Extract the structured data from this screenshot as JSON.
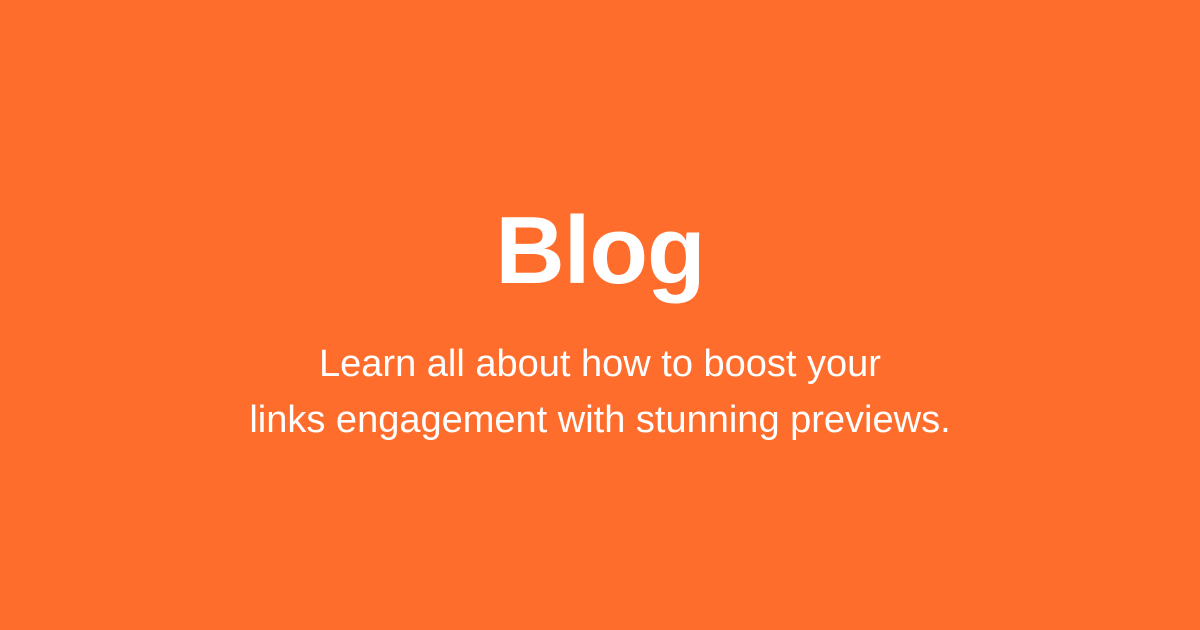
{
  "page": {
    "background_color": "#ff6d2c",
    "text_color": "#ffffff"
  },
  "hero": {
    "title": "Blog",
    "subtitle_lines": [
      "Learn all about how to boost your",
      "links engagement with stunning previews."
    ]
  }
}
